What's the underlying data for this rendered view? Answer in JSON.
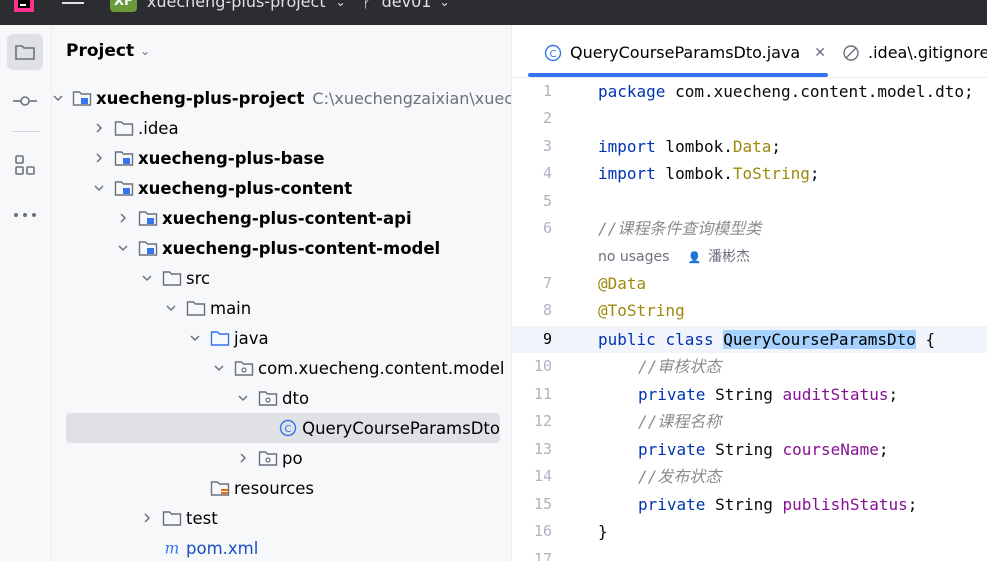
{
  "titlebar": {
    "project_badge": "XF",
    "project_name": "xuecheng-plus-project",
    "branch": "dev01"
  },
  "panel": {
    "title": "Project"
  },
  "tree": [
    {
      "label": "xuecheng-plus-project",
      "path": "C:\\xuechengzaixian\\xuec",
      "depth": 0,
      "expanded": true,
      "icon": "module-folder-icon",
      "bold": true
    },
    {
      "label": ".idea",
      "depth": 1,
      "expanded": false,
      "icon": "folder-icon",
      "bold": false
    },
    {
      "label": "xuecheng-plus-base",
      "depth": 1,
      "expanded": false,
      "icon": "module-folder-icon",
      "bold": true
    },
    {
      "label": "xuecheng-plus-content",
      "depth": 1,
      "expanded": true,
      "icon": "module-folder-icon",
      "bold": true
    },
    {
      "label": "xuecheng-plus-content-api",
      "depth": 2,
      "expanded": false,
      "icon": "module-folder-icon",
      "bold": true
    },
    {
      "label": "xuecheng-plus-content-model",
      "depth": 2,
      "expanded": true,
      "icon": "module-folder-icon",
      "bold": true
    },
    {
      "label": "src",
      "depth": 3,
      "expanded": true,
      "icon": "folder-icon",
      "bold": false
    },
    {
      "label": "main",
      "depth": 4,
      "expanded": true,
      "icon": "folder-icon",
      "bold": false
    },
    {
      "label": "java",
      "depth": 5,
      "expanded": true,
      "icon": "source-folder-icon",
      "bold": false
    },
    {
      "label": "com.xuecheng.content.model",
      "depth": 6,
      "expanded": true,
      "icon": "package-icon",
      "bold": false
    },
    {
      "label": "dto",
      "depth": 7,
      "expanded": true,
      "icon": "package-icon",
      "bold": false
    },
    {
      "label": "QueryCourseParamsDto",
      "depth": 8,
      "leaf": true,
      "icon": "java-class-icon",
      "bold": false,
      "selected": true
    },
    {
      "label": "po",
      "depth": 7,
      "expanded": false,
      "icon": "package-icon",
      "bold": false
    },
    {
      "label": "resources",
      "depth": 5,
      "leaf": true,
      "icon": "resources-folder-icon",
      "bold": false
    },
    {
      "label": "test",
      "depth": 3,
      "expanded": false,
      "icon": "folder-icon",
      "bold": false
    },
    {
      "label": "pom.xml",
      "depth": 3,
      "leaf": true,
      "icon": "maven-icon",
      "bold": false
    }
  ],
  "tabs": [
    {
      "label": "QueryCourseParamsDto.java",
      "active": true
    },
    {
      "label": ".idea\\.gitignore",
      "active": false
    }
  ],
  "code": {
    "line_numbers": [
      "1",
      "2",
      "3",
      "4",
      "5",
      "6",
      "7",
      "8",
      "9",
      "10",
      "11",
      "12",
      "13",
      "14",
      "15",
      "16",
      "17"
    ],
    "lines": {
      "l1_kw": "package",
      "l1_rest": " com.xuecheng.content.model.dto;",
      "l3_kw": "import",
      "l3_pkg": " lombok.",
      "l3_cls": "Data",
      "l3_end": ";",
      "l4_kw": "import",
      "l4_pkg": " lombok.",
      "l4_cls": "ToString",
      "l4_end": ";",
      "l6_comment": "//课程条件查询模型类",
      "usages": "no usages",
      "author": "潘彬杰",
      "l7_ann": "@Data",
      "l8_ann": "@ToString",
      "l9_kw1": "public",
      "l9_kw2": "class",
      "l9_cls": "QueryCourseParamsDto",
      "l9_brace": " {",
      "l10_comment": "//审核状态",
      "l11_kw": "private",
      "l11_type": " String ",
      "l11_field": "auditStatus",
      "l11_end": ";",
      "l12_comment": "//课程名称",
      "l13_kw": "private",
      "l13_type": " String ",
      "l13_field": "courseName",
      "l13_end": ";",
      "l14_comment": "//发布状态",
      "l15_kw": "private",
      "l15_type": " String ",
      "l15_field": "publishStatus",
      "l15_end": ";",
      "l16": "}"
    }
  }
}
